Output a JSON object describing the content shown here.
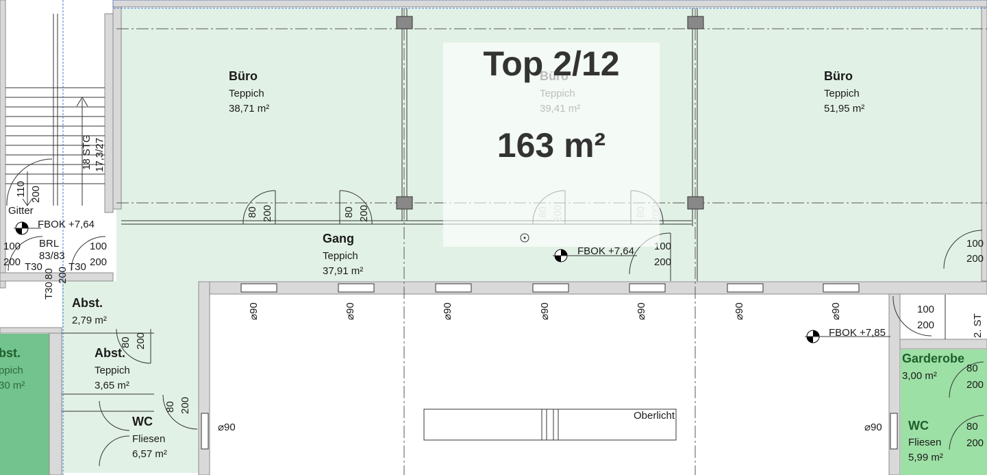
{
  "overlay": {
    "unit": "Top 2/12",
    "area": "163 m²"
  },
  "rooms": {
    "buero1": {
      "name": "Büro",
      "floor": "Teppich",
      "area": "38,71 m²"
    },
    "buero2": {
      "name": "Büro",
      "floor": "Teppich",
      "area": "39,41 m²"
    },
    "buero3": {
      "name": "Büro",
      "floor": "Teppich",
      "area": "51,95 m²"
    },
    "gang": {
      "name": "Gang",
      "floor": "Teppich",
      "area": "37,91 m²"
    },
    "abst1": {
      "name": "Abst.",
      "area": "2,79 m²"
    },
    "abst2": {
      "name": "Abst.",
      "floor": "Teppich",
      "area": "3,65 m²"
    },
    "abst3": {
      "name": "bst.",
      "floor": "ppich",
      "area": "30 m²"
    },
    "wc1": {
      "name": "WC",
      "floor": "Fliesen",
      "area": "6,57 m²"
    },
    "garderobe": {
      "name": "Garderobe",
      "area": "3,00 m²"
    },
    "wc2": {
      "name": "WC",
      "floor": "Fliesen",
      "area": "5,99 m²"
    }
  },
  "levels": {
    "fbok1": "FBOK +7,64",
    "fbok2": "FBOK +7,64",
    "fbok3": "FBOK +7,85"
  },
  "labels": {
    "gitter": "Gitter",
    "brl": "BRL",
    "brl_val": "83/83",
    "t30a": "T30",
    "t30b": "T30",
    "t30c": "T30",
    "eighty": "80",
    "stg": "18 STG",
    "stg_val": "17,3/27",
    "oberlicht": "Oberlicht",
    "st": "2. ST"
  },
  "doors": {
    "d80": "80",
    "d100": "100",
    "d110": "110",
    "d200": "200"
  },
  "pipes": {
    "d90": "⌀90"
  }
}
